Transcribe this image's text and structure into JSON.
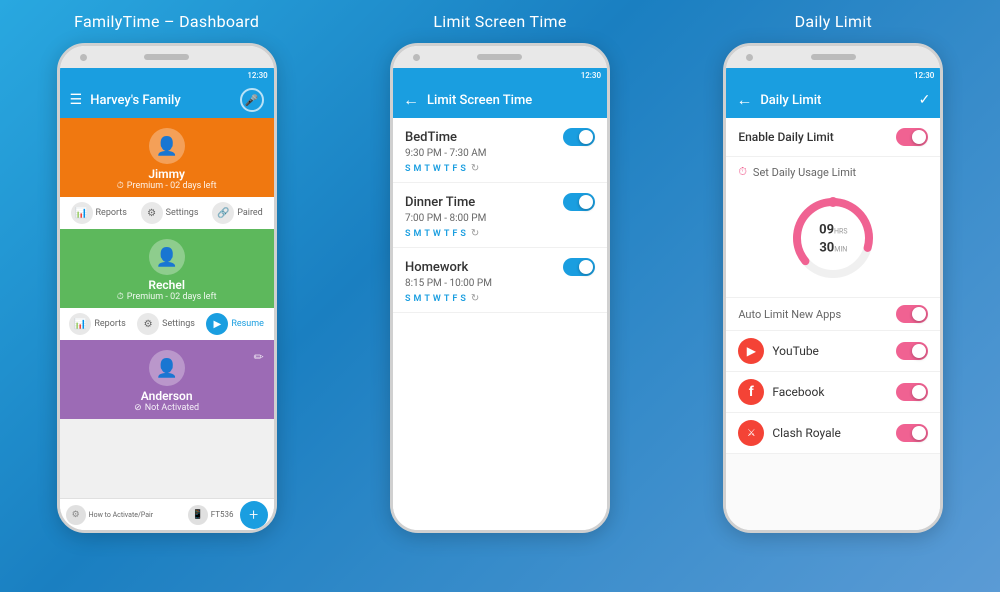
{
  "background": {
    "gradient_start": "#29a8e0",
    "gradient_end": "#1a7fc1"
  },
  "panel1": {
    "title": "FamilyTime – Dashboard",
    "header": {
      "family_name": "Harvey's Family"
    },
    "status_bar_time": "12:30",
    "users": [
      {
        "name": "Jimmy",
        "status": "Premium - 02 days left",
        "card_color": "#f07810",
        "actions": [
          "Reports",
          "Settings",
          "Paired"
        ]
      },
      {
        "name": "Rechel",
        "status": "Premium - 02 days left",
        "card_color": "#5db85c",
        "actions": [
          "Reports",
          "Settings",
          "Resume"
        ]
      },
      {
        "name": "Anderson",
        "status": "Not Activated",
        "card_color": "#9c6bb5",
        "actions": []
      }
    ],
    "bottom": {
      "activate_label": "How to Activate/Pair",
      "ft_label": "FT536",
      "fab_label": "+"
    }
  },
  "panel2": {
    "title": "Limit Screen Time",
    "header": {
      "screen_title": "Limit Screen Time"
    },
    "status_bar_time": "12:30",
    "entries": [
      {
        "label": "BedTime",
        "time_range": "9:30 PM - 7:30 AM",
        "days": [
          "S",
          "M",
          "T",
          "W",
          "T",
          "F",
          "S"
        ],
        "enabled": true
      },
      {
        "label": "Dinner Time",
        "time_range": "7:00 PM - 8:00 PM",
        "days": [
          "S",
          "M",
          "T",
          "W",
          "T",
          "F",
          "S"
        ],
        "enabled": true
      },
      {
        "label": "Homework",
        "time_range": "8:15 PM - 10:00 PM",
        "days": [
          "S",
          "M",
          "T",
          "W",
          "T",
          "F",
          "S"
        ],
        "enabled": true
      }
    ]
  },
  "panel3": {
    "title": "Daily Limit",
    "header": {
      "screen_title": "Daily Limit"
    },
    "status_bar_time": "12:30",
    "enable_daily_limit_label": "Enable Daily Limit",
    "enable_daily_limit": true,
    "set_usage_limit_label": "Set Daily Usage Limit",
    "dial": {
      "hours": "09",
      "hrs_label": "HRS",
      "mins": "30",
      "min_label": "MIN"
    },
    "auto_limit_label": "Auto Limit New Apps",
    "apps": [
      {
        "name": "YouTube",
        "enabled": true,
        "icon": "▶"
      },
      {
        "name": "Facebook",
        "enabled": true,
        "icon": "f"
      },
      {
        "name": "Clash Royale",
        "enabled": true,
        "icon": "⚔"
      }
    ]
  }
}
